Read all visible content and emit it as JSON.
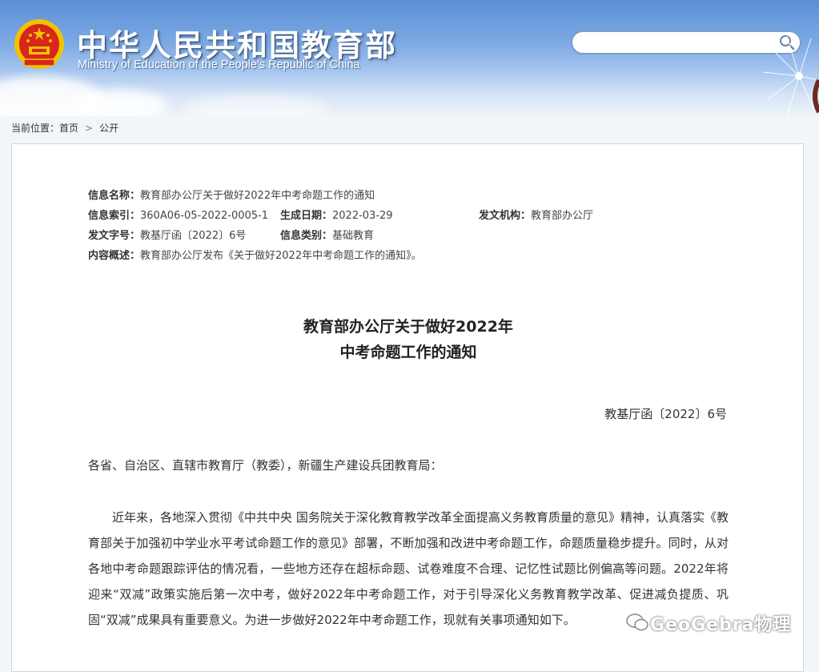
{
  "header": {
    "title_cn": "中华人民共和国教育部",
    "title_en": "Ministry of Education of the People's Republic of China",
    "search_placeholder": ""
  },
  "breadcrumb": {
    "prefix": "当前位置：",
    "home": "首页",
    "separator": ">",
    "current": "公开"
  },
  "meta": {
    "name_label": "信息名称：",
    "name_value": "教育部办公厅关于做好2022年中考命题工作的通知",
    "index_label": "信息索引：",
    "index_value": "360A06-05-2022-0005-1",
    "date_label": "生成日期：",
    "date_value": "2022-03-29",
    "org_label": "发文机构：",
    "org_value": "教育部办公厅",
    "docno_label": "发文字号：",
    "docno_value": "教基厅函〔2022〕6号",
    "category_label": "信息类别：",
    "category_value": "基础教育",
    "summary_label": "内容概述：",
    "summary_value": "教育部办公厅发布《关于做好2022年中考命题工作的通知》。"
  },
  "document": {
    "title_line1": "教育部办公厅关于做好2022年",
    "title_line2": "中考命题工作的通知",
    "doc_number": "教基厅函〔2022〕6号",
    "salutation": "各省、自治区、直辖市教育厅（教委），新疆生产建设兵团教育局：",
    "paragraph1": "近年来，各地深入贯彻《中共中央 国务院关于深化教育教学改革全面提高义务教育质量的意见》精神，认真落实《教育部关于加强初中学业水平考试命题工作的意见》部署，不断加强和改进中考命题工作，命题质量稳步提升。同时，从对各地中考命题跟踪评估的情况看，一些地方还存在超标命题、试卷难度不合理、记忆性试题比例偏高等问题。2022年将迎来“双减”政策实施后第一次中考，做好2022年中考命题工作，对于引导深化义务教育教学改革、促进减负提质、巩固“双减”成果具有重要意义。为进一步做好2022年中考命题工作，现就有关事项通知如下。"
  },
  "watermark": {
    "text": "GeoGebra物理"
  },
  "colors": {
    "header_top": "#5b8fd6",
    "search_border": "#7a9cc8",
    "emblem_red": "#d8261c",
    "emblem_gold": "#f2c200"
  }
}
